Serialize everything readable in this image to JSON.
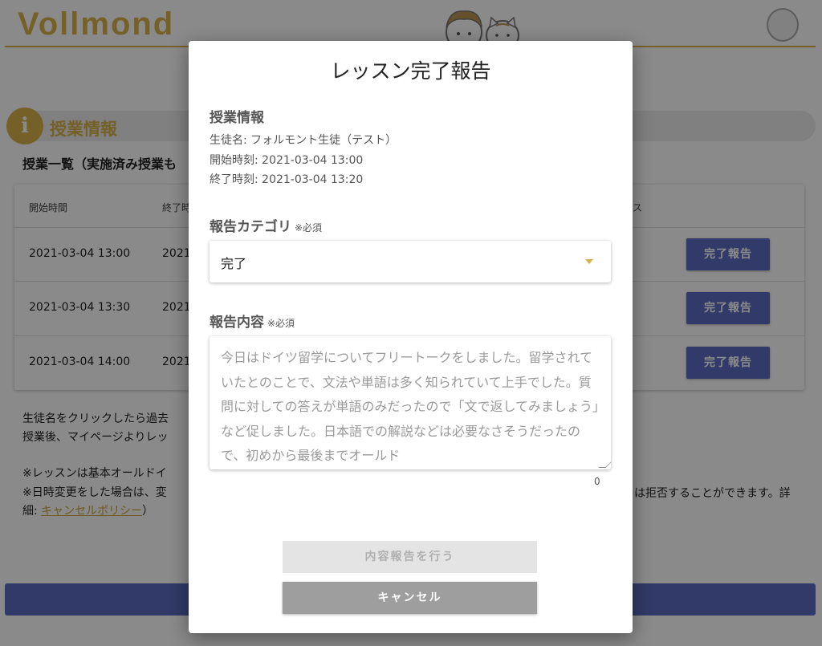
{
  "header": {
    "logo_text": "Vollmond",
    "accent_color": "#d8b24a"
  },
  "section": {
    "icon": "info-icon",
    "icon_glyph": "i",
    "title": "授業情報"
  },
  "lesson_list": {
    "title": "授業一覧（実施済み授業も",
    "columns": [
      "開始時間",
      "終了時",
      "ス"
    ],
    "rows": [
      {
        "start": "2021-03-04 13:00",
        "end": "2021",
        "action": "完了報告"
      },
      {
        "start": "2021-03-04 13:30",
        "end": "2021",
        "action": "完了報告"
      },
      {
        "start": "2021-03-04 14:00",
        "end": "2021",
        "action": "完了報告"
      }
    ]
  },
  "notes": {
    "line1": "生徒名をクリックしたら過去",
    "line2": "授業後、マイページよりレッ",
    "line3": "※レッスンは基本オールドイ",
    "line4": "※日時変更をした場合は、変",
    "line4_right": "は拒否することができます。詳",
    "line5_prefix": "細: ",
    "line5_link": "キャンセルポリシー",
    "line5_suffix": "）"
  },
  "dialog": {
    "title": "レッスン完了報告",
    "info_title": "授業情報",
    "student": "生徒名: フォルモント生徒（テスト）",
    "start_time": "開始時刻: 2021-03-04 13:00",
    "end_time": "終了時刻: 2021-03-04 13:20",
    "category_label": "報告カテゴリ",
    "category_required": "※必須",
    "category_value": "完了",
    "content_label": "報告内容",
    "content_required": "※必須",
    "content_placeholder": "今日はドイツ留学についてフリートークをしました。留学されていたとのことで、文法や単語は多く知られていて上手でした。質問に対しての答えが単語のみだったので「文で返してみましょう」など促しました。日本語での解説などは必要なさそうだったので、初めから最後までオールド",
    "char_count": "0",
    "submit_label": "内容報告を行う",
    "cancel_label": "キャンセル"
  },
  "colors": {
    "primary": "#5c6bc0",
    "accent": "#d8b24a",
    "disabled": "#e4e4e4",
    "cancel": "#9e9e9e"
  }
}
